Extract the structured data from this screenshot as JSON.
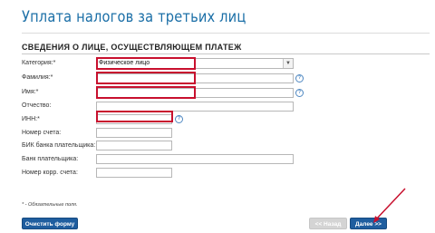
{
  "page": {
    "title": "Уплата налогов за третьих лиц"
  },
  "section": {
    "title": "СВЕДЕНИЯ О ЛИЦЕ, ОСУЩЕСТВЛЯЮЩЕМ ПЛАТЕЖ"
  },
  "fields": {
    "category": {
      "label": "Категория:*",
      "value": "Физическое лицо"
    },
    "surname": {
      "label": "Фамилия:*",
      "value": ""
    },
    "name": {
      "label": "Имя:*",
      "value": ""
    },
    "patronymic": {
      "label": "Отчество:",
      "value": ""
    },
    "inn": {
      "label": "ИНН:*",
      "value": ""
    },
    "account_number": {
      "label": "Номер счета:",
      "value": ""
    },
    "payer_bank_bik": {
      "label": "БИК банка плательщика:",
      "value": ""
    },
    "payer_bank": {
      "label": "Банк плательщика:",
      "value": ""
    },
    "corr_account": {
      "label": "Номер корр. счета:",
      "value": ""
    }
  },
  "help_icon_glyph": "?",
  "footnote": "* - Обязательные поля.",
  "buttons": {
    "clear": "Очистить форму",
    "back": "<< Назад",
    "next": "Далее >>"
  },
  "colors": {
    "accent": "#1f5e9f",
    "title": "#1b6fa7",
    "highlight": "#c8102e",
    "disabled": "#d4d4d4"
  }
}
